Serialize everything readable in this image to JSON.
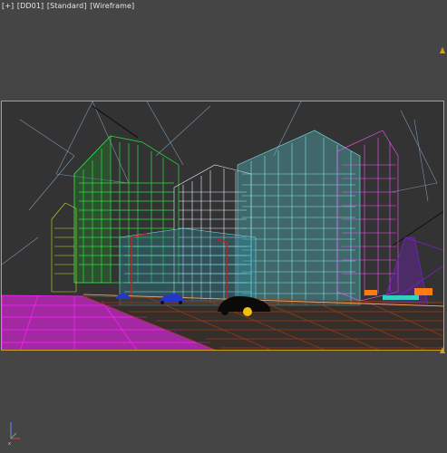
{
  "viewport": {
    "labels": [
      "[+]",
      "[DD01]",
      "[Standard]",
      "[Wireframe]"
    ],
    "mode": "Wireframe",
    "background_color": "#454545",
    "safe_frame_color": "#c9a227"
  },
  "scene": {
    "description_icons": [
      "building-wireframe",
      "street-lamp",
      "car",
      "crane"
    ],
    "palette": {
      "green_tower": "#2ee040",
      "white_block": "#e8f4ff",
      "cyan_block": "#7fe8ec",
      "magenta_ground": "#ff20ff",
      "road_grid": "#9b3c12",
      "sky_lines": "#8ab0d8",
      "purple_crane": "#7a20c8",
      "orange_props": "#ff7a10",
      "black_car": "#0a0a0a",
      "blue_car": "#2338c8"
    }
  },
  "gizmo": {
    "axes": [
      "x",
      "y",
      "z"
    ]
  }
}
